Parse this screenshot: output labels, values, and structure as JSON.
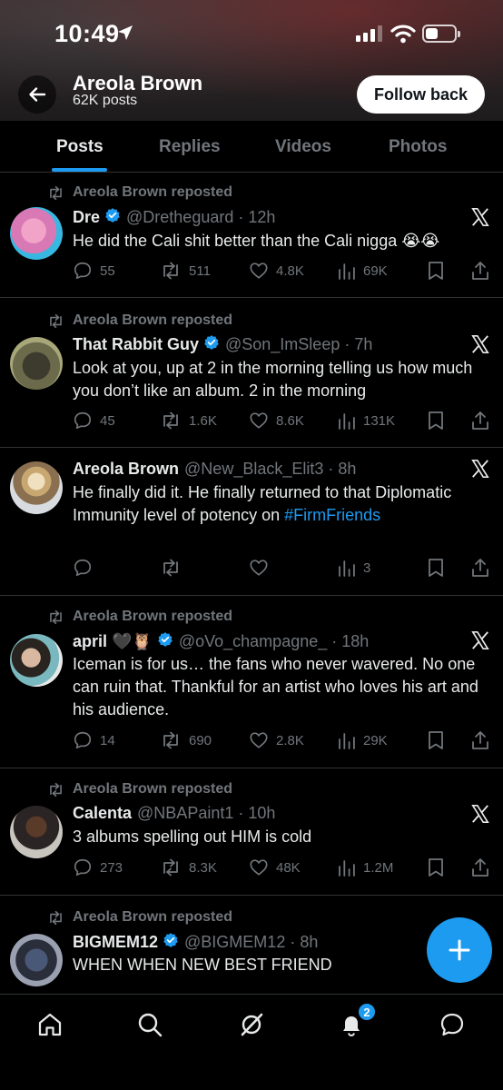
{
  "status_bar": {
    "time": "10:49"
  },
  "header": {
    "name": "Areola Brown",
    "post_count": "62K posts",
    "follow_label": "Follow back"
  },
  "tabs": [
    {
      "label": "Posts",
      "active": true
    },
    {
      "label": "Replies",
      "active": false
    },
    {
      "label": "Videos",
      "active": false
    },
    {
      "label": "Photos",
      "active": false
    }
  ],
  "posts": [
    {
      "repost_label": "Areola Brown reposted",
      "name": "Dre",
      "verified": true,
      "handle": "@Dretheguard",
      "time": "12h",
      "text": "He did the Cali shit better than the Cali nigga 😭😭",
      "replies": "55",
      "reposts": "511",
      "likes": "4.8K",
      "views": "69K"
    },
    {
      "repost_label": "Areola Brown reposted",
      "name": "That Rabbit Guy",
      "verified": true,
      "handle": "@Son_ImSleep",
      "time": "7h",
      "text": "Look at you, up at 2 in the morning telling us how much you don’t like an album. 2 in the morning",
      "replies": "45",
      "reposts": "1.6K",
      "likes": "8.6K",
      "views": "131K"
    },
    {
      "repost_label": "",
      "name": "Areola Brown",
      "verified": false,
      "handle": "@New_Black_Elit3",
      "time": "8h",
      "text": "He finally did it. He finally returned to that Diplomatic Immunity level of potency on",
      "hashtag": "#FirmFriends",
      "replies": "",
      "reposts": "",
      "likes": "",
      "views": "3"
    },
    {
      "repost_label": "Areola Brown reposted",
      "name": "april 🖤🦉",
      "verified": true,
      "handle": "@oVo_champagne_",
      "time": "18h",
      "text": "Iceman is for us… the fans who never wavered. No one can ruin that. Thankful for an artist who loves his art and his audience.",
      "replies": "14",
      "reposts": "690",
      "likes": "2.8K",
      "views": "29K"
    },
    {
      "repost_label": "Areola Brown reposted",
      "name": "Calenta",
      "verified": false,
      "handle": "@NBAPaint1",
      "time": "10h",
      "text": "3 albums spelling out HIM is cold",
      "replies": "273",
      "reposts": "8.3K",
      "likes": "48K",
      "views": "1.2M"
    },
    {
      "repost_label": "Areola Brown reposted",
      "name": "BIGMEM12",
      "verified": true,
      "handle": "@BIGMEM12",
      "time": "8h",
      "text": "WHEN WHEN NEW BEST FRIEND"
    }
  ],
  "bottom_nav": {
    "notification_count": "2",
    "icons": [
      "home-icon",
      "search-icon",
      "grok-icon",
      "bell-icon",
      "messages-icon"
    ]
  },
  "colors": {
    "accent": "#1d9bf0",
    "text": "#e7e9ea",
    "muted": "#71767b",
    "divider": "#2f3336"
  }
}
